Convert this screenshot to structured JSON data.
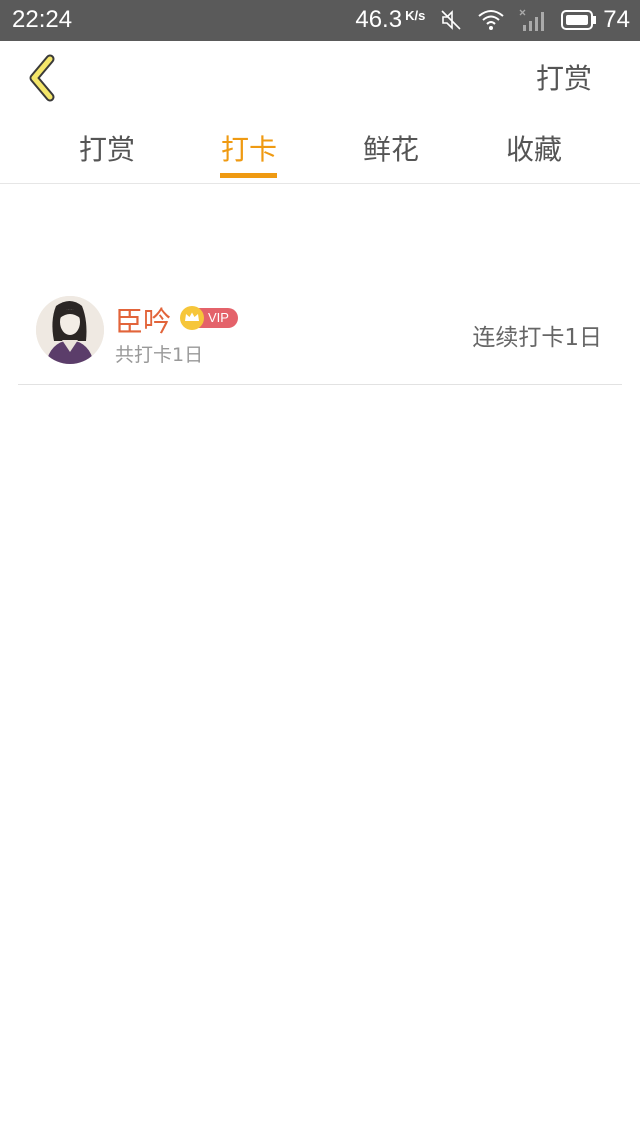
{
  "status_bar": {
    "time": "22:24",
    "speed_value": "46.3",
    "speed_unit": "K/s",
    "battery_level": "74",
    "icons": [
      "mute-icon",
      "wifi-icon",
      "signal-icon",
      "battery-icon"
    ]
  },
  "nav": {
    "back_icon": "chevron-left-icon",
    "right_action": "打赏"
  },
  "tabs": [
    {
      "label": "打赏",
      "active": false
    },
    {
      "label": "打卡",
      "active": true
    },
    {
      "label": "鲜花",
      "active": false
    },
    {
      "label": "收藏",
      "active": false
    }
  ],
  "list": [
    {
      "name": "臣吟",
      "badge": "VIP",
      "total_text": "共打卡1日",
      "streak_text": "连续打卡1日"
    }
  ],
  "colors": {
    "accent": "#ef9a12",
    "name": "#e2643a",
    "vip_badge": "#e4626a",
    "status_bar": "#5a5a5a"
  }
}
